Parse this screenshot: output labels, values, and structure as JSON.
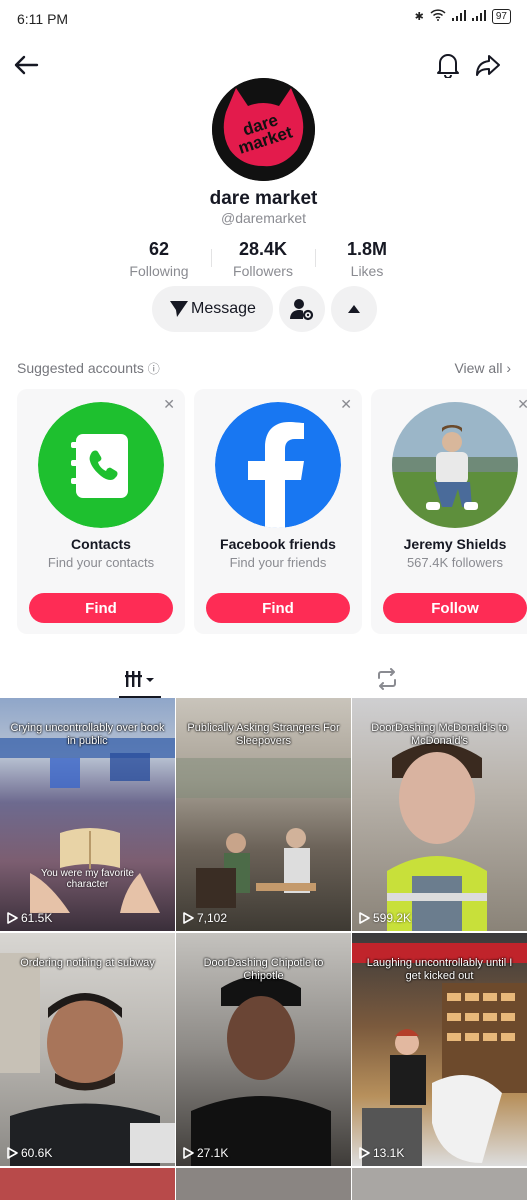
{
  "status": {
    "time": "6:11 PM",
    "battery": "97"
  },
  "profile": {
    "avatar_text": "dare market",
    "name": "dare market",
    "handle": "@daremarket",
    "stats": [
      {
        "value": "62",
        "label": "Following"
      },
      {
        "value": "28.4K",
        "label": "Followers"
      },
      {
        "value": "1.8M",
        "label": "Likes"
      }
    ],
    "message_label": "Message"
  },
  "suggested": {
    "title": "Suggested accounts",
    "view_all": "View all",
    "cards": [
      {
        "title": "Contacts",
        "subtitle": "Find your contacts",
        "button": "Find"
      },
      {
        "title": "Facebook friends",
        "subtitle": "Find your friends",
        "button": "Find"
      },
      {
        "title": "Jeremy Shields",
        "subtitle": "567.4K followers",
        "button": "Follow"
      }
    ]
  },
  "videos": [
    {
      "caption": "Crying uncontrollably over book in public",
      "overlay": "You were my favorite character",
      "views": "61.5K"
    },
    {
      "caption": "Publically Asking Strangers For Sleepovers",
      "views": "7,102"
    },
    {
      "caption": "DoorDashing McDonald's to McDonald's",
      "views": "599.2K"
    },
    {
      "caption": "Ordering nothing at subway",
      "views": "60.6K"
    },
    {
      "caption": "DoorDashing Chipotle to Chipotle",
      "views": "27.1K"
    },
    {
      "caption": "Laughing uncontrollably until I get kicked out",
      "views": "13.1K"
    }
  ],
  "colors": {
    "accent": "#fe2c55",
    "contacts_green": "#1ec02f",
    "facebook_blue": "#1877f2"
  }
}
